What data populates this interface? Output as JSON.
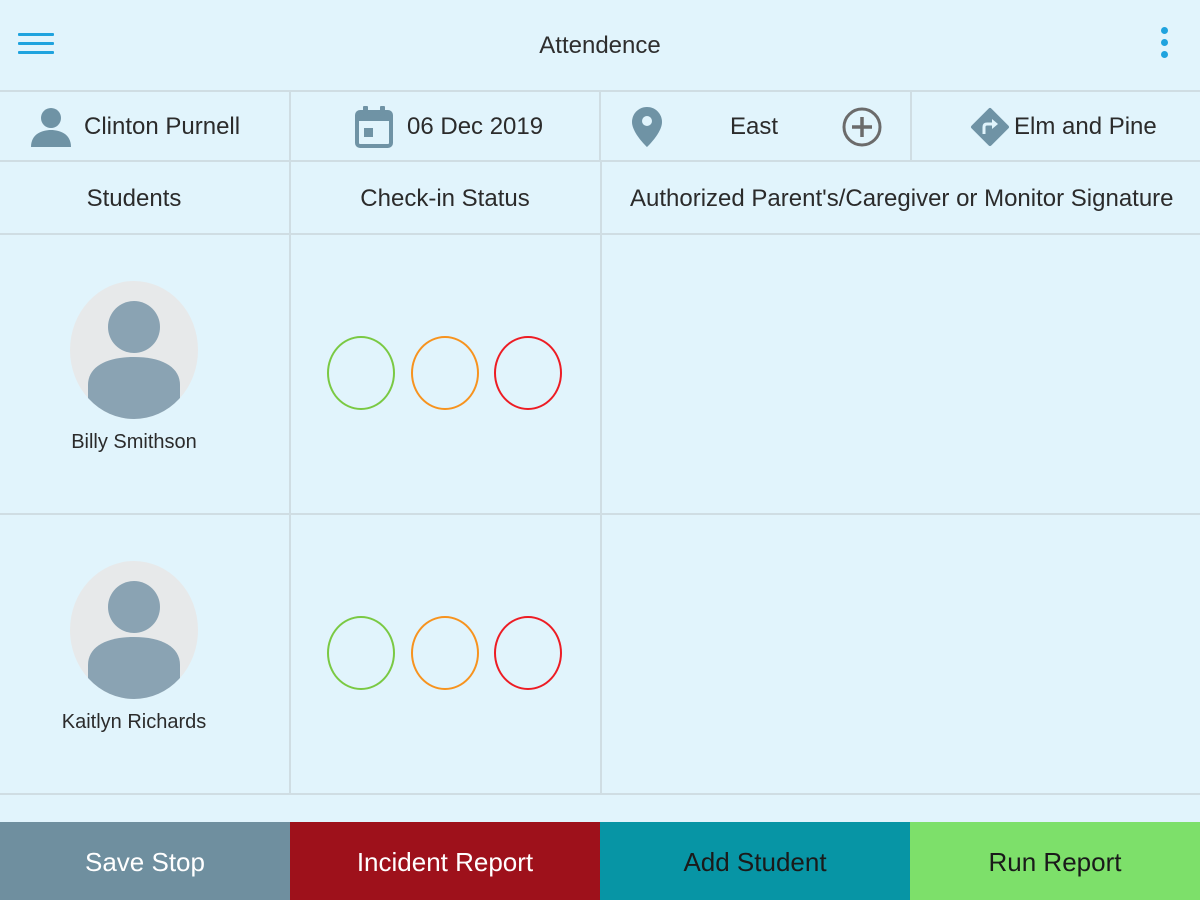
{
  "appbar": {
    "title": "Attendence",
    "menu_icon": "hamburger-menu-icon",
    "overflow_icon": "more-vertical-icon",
    "accent": "#1fa3de"
  },
  "info": {
    "driver": "Clinton Purnell",
    "date": "06 Dec 2019",
    "direction": "East",
    "route": "Elm and Pine",
    "icon_color": "#6f93a5",
    "add_icon_color": "#6b6b6b"
  },
  "table": {
    "headers": [
      "Students",
      "Check-in Status",
      "Authorized Parent's/Caregiver or Monitor Signature"
    ],
    "students": [
      {
        "name": "Billy Smithson"
      },
      {
        "name": "Kaitlyn Richards"
      }
    ],
    "status_colors": {
      "green": "#7ac943",
      "orange": "#f7931e",
      "red": "#ed1c24"
    }
  },
  "buttons": [
    {
      "label": "Save Stop",
      "bg": "#6f8f9f",
      "fg": "#ffffff"
    },
    {
      "label": "Incident Report",
      "bg": "#9e111b",
      "fg": "#ffffff"
    },
    {
      "label": "Add Student",
      "bg": "#0795a5",
      "fg": "#1a1a1a"
    },
    {
      "label": "Run Report",
      "bg": "#7de06a",
      "fg": "#1a1a1a"
    }
  ]
}
